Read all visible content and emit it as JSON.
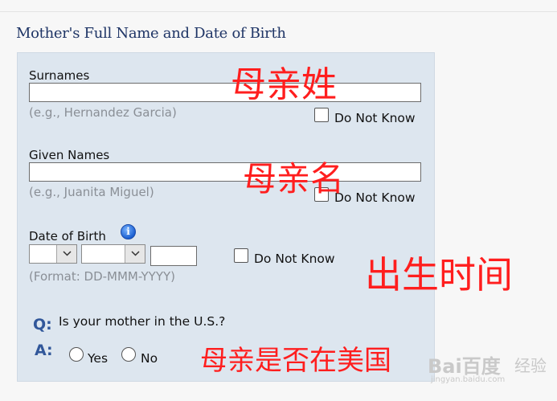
{
  "section_title": "Mother's Full Name and Date of Birth",
  "surnames": {
    "label": "Surnames",
    "value": "",
    "hint": "(e.g., Hernandez Garcia)",
    "dnk_label": "Do Not Know"
  },
  "given_names": {
    "label": "Given Names",
    "value": "",
    "hint": "(e.g., Juanita Miguel)",
    "dnk_label": "Do Not Know"
  },
  "dob": {
    "label": "Date of Birth",
    "info_glyph": "i",
    "day_value": "",
    "month_value": "",
    "year_value": "",
    "format_hint": "(Format: DD-MMM-YYYY)",
    "dnk_label": "Do Not Know"
  },
  "in_us": {
    "q_marker": "Q:",
    "question": "Is your mother in the U.S.?",
    "a_marker": "A:",
    "yes_label": "Yes",
    "no_label": "No"
  },
  "annotations": {
    "surname": "母亲姓",
    "given": "母亲名",
    "dob": "出生时间",
    "in_us": "母亲是否在美国"
  },
  "watermark": {
    "brand": "Bai百度",
    "sub": "经验",
    "url": "jingyan.baidu.com"
  },
  "colors": {
    "panel": "#dde6ef",
    "title": "#1f3566",
    "annotation": "#ff1e1e",
    "qa_marker": "#31579a"
  }
}
